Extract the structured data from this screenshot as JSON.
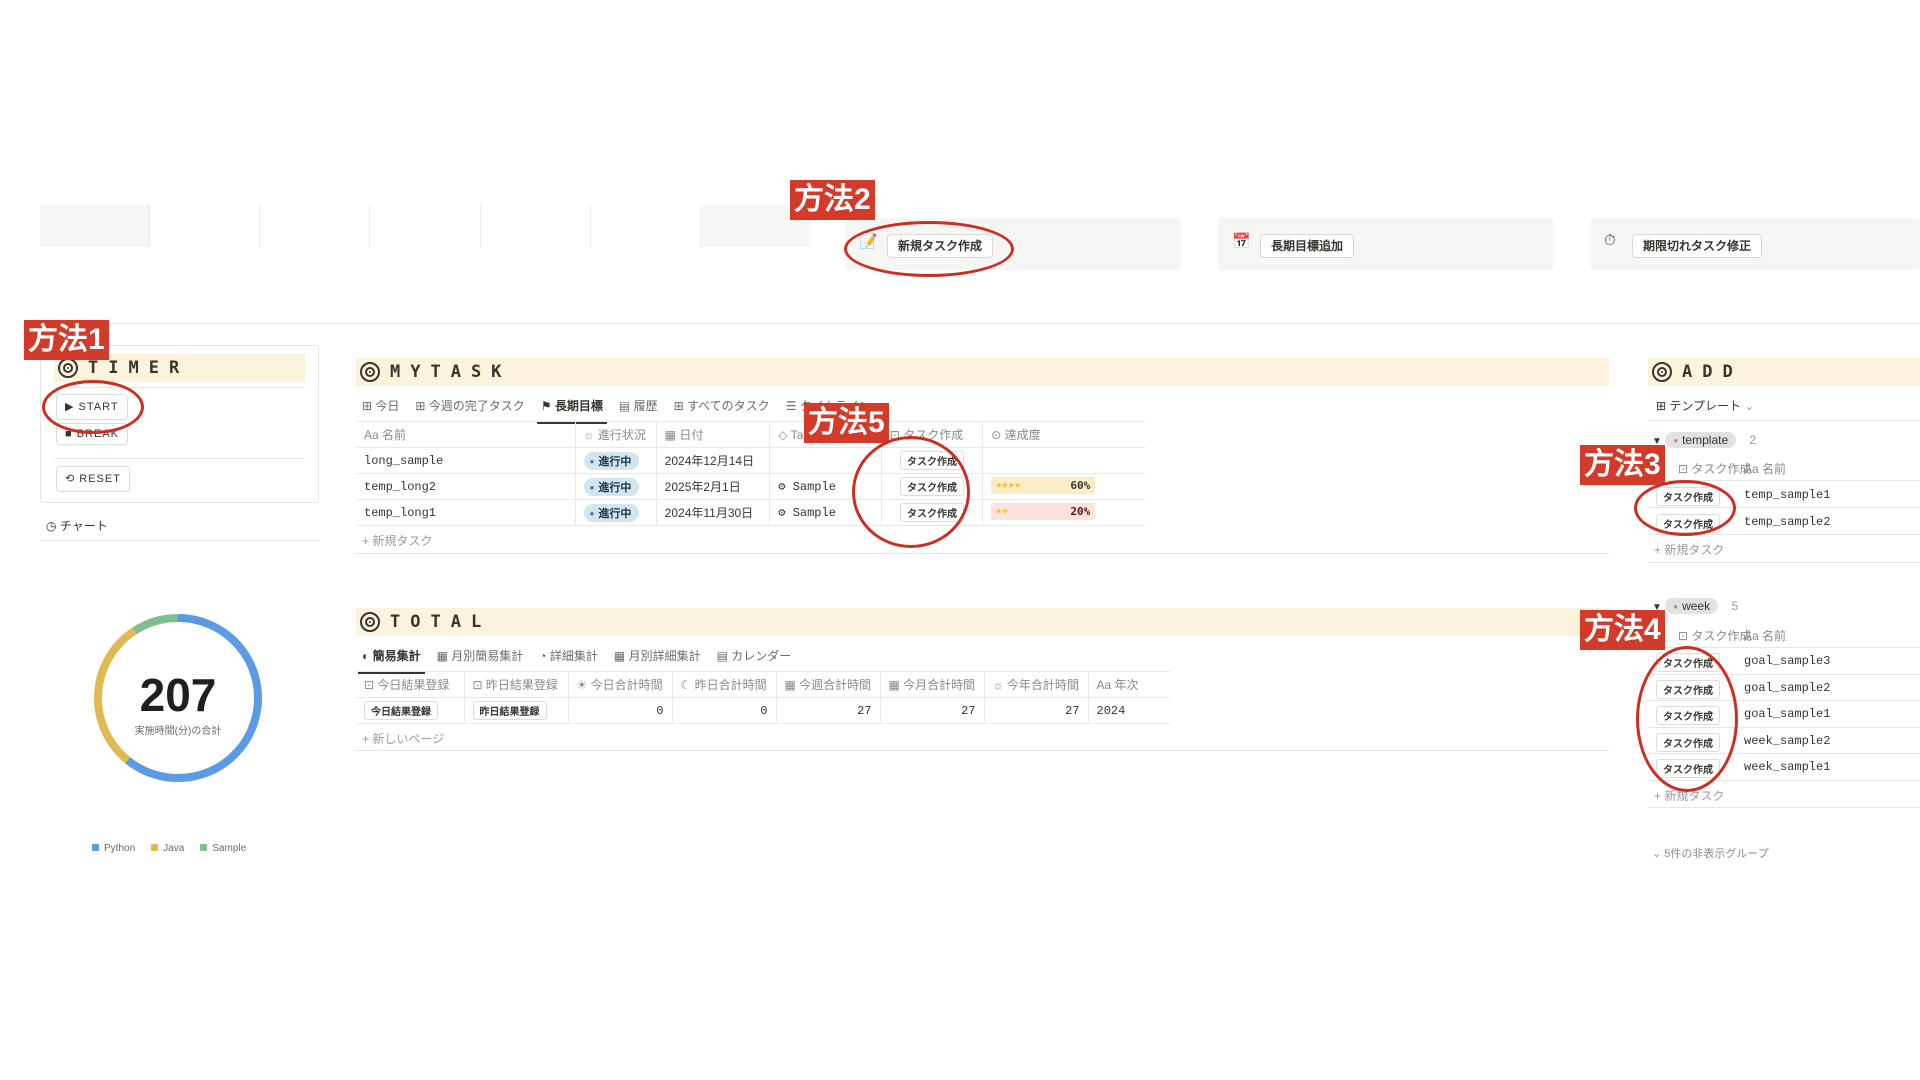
{
  "top_buttons": [
    {
      "label": "新規タスク作成",
      "icon": "memo-icon"
    },
    {
      "label": "長期目標追加",
      "icon": "calendar-icon"
    },
    {
      "label": "期限切れタスク修正",
      "icon": "stopwatch-icon"
    }
  ],
  "timer": {
    "title": "TIMER",
    "start_label": "START",
    "break_label": "BREAK",
    "reset_label": "RESET",
    "chart_label": "チャート"
  },
  "donut": {
    "total": "207",
    "label": "実施時間(分)の合計",
    "legend": [
      "Python",
      "Java",
      "Sample"
    ],
    "colors": {
      "Python": "#5b9be3",
      "Java": "#e0b952",
      "Sample": "#7fbf8e"
    }
  },
  "chart_data": {
    "type": "pie",
    "title": "",
    "categories": [
      "Python",
      "Java",
      "Sample"
    ],
    "values": [
      126,
      62,
      19
    ],
    "center_value": 207
  },
  "mytask": {
    "title": "MYTASK",
    "tabs": [
      "今日",
      "今週の完了タスク",
      "長期目標",
      "履歴",
      "すべてのタスク",
      "タイムライン"
    ],
    "active_tab": "長期目標",
    "columns": [
      "名前",
      "進行状況",
      "日付",
      "Tag",
      "タスク作成",
      "達成度"
    ],
    "rows": [
      {
        "name": "long_sample",
        "status": "進行中",
        "date": "2024年12月14日",
        "tag": "",
        "action": "タスク作成",
        "progress_pct": null,
        "progress_text": ""
      },
      {
        "name": "temp_long2",
        "status": "進行中",
        "date": "2025年2月1日",
        "tag": "Sample",
        "action": "タスク作成",
        "progress_pct": 60,
        "progress_text": "60%"
      },
      {
        "name": "temp_long1",
        "status": "進行中",
        "date": "2024年11月30日",
        "tag": "Sample",
        "action": "タスク作成",
        "progress_pct": 20,
        "progress_text": "20%"
      }
    ],
    "new_label": "新規タスク"
  },
  "total": {
    "title": "TOTAL",
    "tabs": [
      "簡易集計",
      "月別簡易集計",
      "詳細集計",
      "月別詳細集計",
      "カレンダー"
    ],
    "active_tab": "簡易集計",
    "columns": [
      "今日結果登録",
      "昨日結果登録",
      "今日合計時間",
      "昨日合計時間",
      "今週合計時間",
      "今月合計時間",
      "今年合計時間",
      "年次"
    ],
    "row": {
      "today_btn": "今日結果登録",
      "yesterday_btn": "昨日結果登録",
      "today": "0",
      "yesterday": "0",
      "week": "27",
      "month": "27",
      "year": "27",
      "annual": "2024"
    },
    "new_label": "新しいページ"
  },
  "add": {
    "title": "ADD",
    "view_label": "テンプレート",
    "groups": [
      {
        "name": "template",
        "count": "2",
        "col_action": "タスク作成",
        "col_name": "名前",
        "items": [
          {
            "action": "タスク作成",
            "name": "temp_sample1"
          },
          {
            "action": "タスク作成",
            "name": "temp_sample2"
          }
        ]
      },
      {
        "name": "week",
        "count": "5",
        "col_action": "タスク作成",
        "col_name": "名前",
        "items": [
          {
            "action": "タスク作成",
            "name": "goal_sample3"
          },
          {
            "action": "タスク作成",
            "name": "goal_sample2"
          },
          {
            "action": "タスク作成",
            "name": "goal_sample1"
          },
          {
            "action": "タスク作成",
            "name": "week_sample2"
          },
          {
            "action": "タスク作成",
            "name": "week_sample1"
          }
        ]
      }
    ],
    "new_label": "新規タスク",
    "hidden_groups_label": "5件の非表示グループ"
  },
  "annotations": [
    "方法1",
    "方法2",
    "方法3",
    "方法4",
    "方法5"
  ]
}
